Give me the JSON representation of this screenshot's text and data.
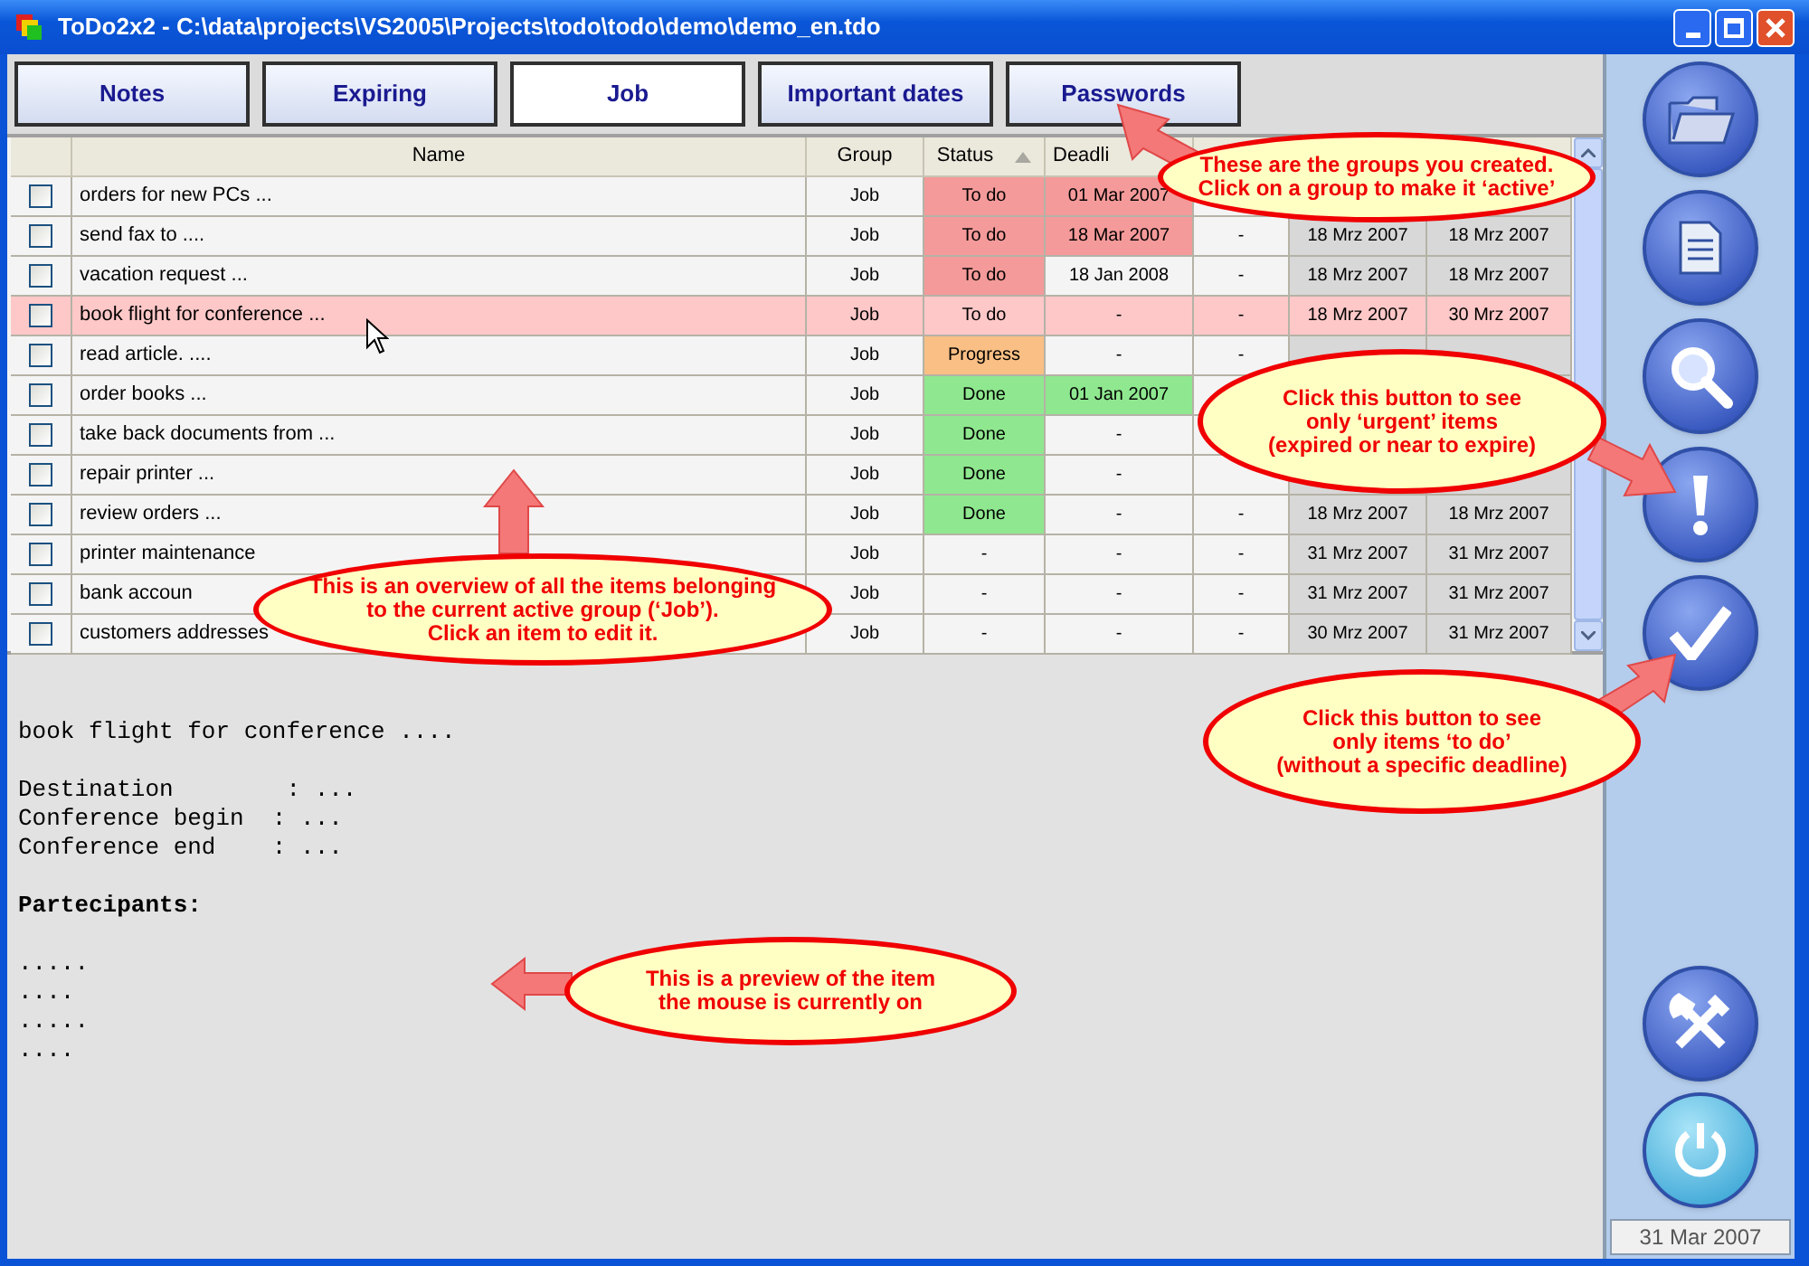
{
  "window": {
    "title": "ToDo2x2 - C:\\data\\projects\\VS2005\\Projects\\todo\\todo\\demo\\demo_en.tdo"
  },
  "groups": [
    {
      "label": "Notes",
      "selected": false
    },
    {
      "label": "Expiring",
      "selected": false
    },
    {
      "label": "Job",
      "selected": true
    },
    {
      "label": "Important dates",
      "selected": false
    },
    {
      "label": "Passwords",
      "selected": false
    }
  ],
  "table": {
    "columns": [
      {
        "label": "Name",
        "sorted": false
      },
      {
        "label": "Group",
        "sorted": false
      },
      {
        "label": "Status",
        "sorted": true
      },
      {
        "label": "Deadli",
        "sorted": false
      }
    ],
    "rows": [
      {
        "checked": false,
        "selected": false,
        "name": "orders for new PCs ...",
        "group": "Job",
        "status": {
          "text": "To do",
          "color": "#f59a9a"
        },
        "deadline": {
          "text": "01 Mar 2007",
          "color": "#f59a9a"
        }
      },
      {
        "checked": false,
        "selected": false,
        "name": "send fax to ....",
        "group": "Job",
        "status": {
          "text": "To do",
          "color": "#f59a9a"
        },
        "deadline": {
          "text": "18 Mar 2007",
          "color": "#f59a9a"
        },
        "column_5": "-",
        "column_6": "18 Mrz 2007",
        "column_7": "18 Mrz 2007"
      },
      {
        "checked": false,
        "selected": false,
        "name": "vacation request ...",
        "group": "Job",
        "status": {
          "text": "To do",
          "color": "#f59a9a"
        },
        "deadline": {
          "text": "18 Jan 2008"
        },
        "column_5": "-",
        "column_6": "18 Mrz 2007",
        "column_7": "18 Mrz 2007"
      },
      {
        "checked": false,
        "selected": true,
        "name": "book flight for conference ...",
        "group": "Job",
        "status": {
          "text": "To do"
        },
        "deadline": {
          "text": "-"
        },
        "column_5": "-",
        "column_6": "18 Mrz 2007",
        "column_7": "30 Mrz 2007"
      },
      {
        "checked": false,
        "selected": false,
        "name": "read article. ....",
        "group": "Job",
        "status": {
          "text": "Progress",
          "color": "#f9bf84"
        },
        "deadline": {
          "text": "-"
        },
        "column_5": "-"
      },
      {
        "checked": false,
        "selected": false,
        "name": "order books ...",
        "group": "Job",
        "status": {
          "text": "Done",
          "color": "#8fe88f"
        },
        "deadline": {
          "text": "01 Jan 2007",
          "color": "#8fe88f"
        }
      },
      {
        "checked": false,
        "selected": false,
        "name": "take back documents from ...",
        "group": "Job",
        "status": {
          "text": "Done",
          "color": "#8fe88f"
        },
        "deadline": {
          "text": "-"
        }
      },
      {
        "checked": false,
        "selected": false,
        "name": "repair printer ...",
        "group": "Job",
        "status": {
          "text": "Done",
          "color": "#8fe88f"
        },
        "deadline": {
          "text": "-"
        }
      },
      {
        "checked": false,
        "selected": false,
        "name": "review orders ...",
        "group": "Job",
        "status": {
          "text": "Done",
          "color": "#8fe88f"
        },
        "deadline": {
          "text": "-"
        },
        "column_5": "-",
        "column_6": "18 Mrz 2007",
        "column_7": "18 Mrz 2007"
      },
      {
        "checked": false,
        "selected": false,
        "name": "printer maintenance",
        "group": "Job",
        "status": {
          "text": "-"
        },
        "deadline": {
          "text": "-"
        },
        "column_5": "-",
        "column_6": "31 Mrz 2007",
        "column_7": "31 Mrz 2007"
      },
      {
        "checked": false,
        "selected": false,
        "name": "bank accoun",
        "group": "Job",
        "status": {
          "text": "-"
        },
        "deadline": {
          "text": "-"
        },
        "column_5": "-",
        "column_6": "31 Mrz 2007",
        "column_7": "31 Mrz 2007"
      },
      {
        "checked": false,
        "selected": false,
        "name": "customers addresses",
        "group": "Job",
        "status": {
          "text": "-"
        },
        "deadline": {
          "text": "-"
        },
        "column_5": "-",
        "column_6": "30 Mrz 2007",
        "column_7": "31 Mrz 2007"
      }
    ]
  },
  "preview": {
    "paragraphs": [
      {
        "bold": false,
        "lines": [
          "book flight for conference ...."
        ]
      },
      {
        "bold": false,
        "lines": [
          "Destination        : ...",
          "Conference begin  : ...",
          "Conference end    : ..."
        ]
      },
      {
        "bold": true,
        "lines": [
          "Partecipants:"
        ]
      },
      {
        "bold": false,
        "lines": [
          ".....",
          "....",
          ".....",
          "...."
        ]
      }
    ]
  },
  "sidebar": {
    "date": "31 Mar 2007"
  },
  "callouts": [
    {
      "kind": "up-left",
      "text": "These are the groups you created.\nClick on a group to make it ‘active’"
    },
    {
      "kind": "up",
      "text": "This is an overview of all the items belonging\nto the current active group (‘Job’).\nClick an item to edit it."
    },
    {
      "kind": "right",
      "text": "Click this button to see\nonly ‘urgent’ items\n(expired or near to expire)"
    },
    {
      "kind": "up-right",
      "text": "Click this button to see\nonly items ‘to do’\n(without a specific deadline)"
    },
    {
      "kind": "left",
      "text": "This is a preview of the item\nthe mouse is currently on"
    }
  ]
}
